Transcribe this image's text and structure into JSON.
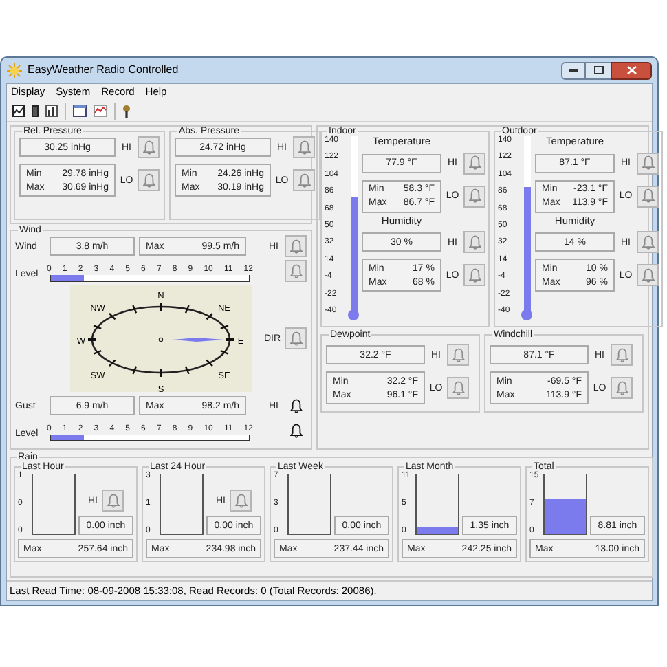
{
  "window": {
    "title": "EasyWeather Radio Controlled"
  },
  "menu": [
    "Display",
    "System",
    "Record",
    "Help"
  ],
  "pressure": [
    {
      "title": "Rel. Pressure",
      "value": "30.25 inHg",
      "hi_label": "HI",
      "lo_label": "LO",
      "min_label": "Min",
      "min": "29.78 inHg",
      "max_label": "Max",
      "max": "30.69 inHg"
    },
    {
      "title": "Abs. Pressure",
      "value": "24.72 inHg",
      "hi_label": "HI",
      "lo_label": "LO",
      "min_label": "Min",
      "min": "24.26 inHg",
      "max_label": "Max",
      "max": "30.19 inHg"
    }
  ],
  "wind": {
    "title": "Wind",
    "dir_label": "DIR",
    "compass": [
      "N",
      "NE",
      "E",
      "SE",
      "S",
      "SW",
      "W",
      "NW"
    ],
    "rows": [
      {
        "label": "Wind",
        "value": "3.8 m/h",
        "max_label": "Max",
        "max": "99.5 m/h",
        "hi_label": "HI",
        "alarm_active": false,
        "level_label": "Level",
        "scale": [
          "0",
          "1",
          "2",
          "3",
          "4",
          "5",
          "6",
          "7",
          "8",
          "9",
          "10",
          "11",
          "12"
        ],
        "level": 0.167
      },
      {
        "label": "Gust",
        "value": "6.9 m/h",
        "max_label": "Max",
        "max": "98.2 m/h",
        "hi_label": "HI",
        "alarm_active": true,
        "level_label": "Level",
        "scale": [
          "0",
          "1",
          "2",
          "3",
          "4",
          "5",
          "6",
          "7",
          "8",
          "9",
          "10",
          "11",
          "12"
        ],
        "level": 0.167
      }
    ]
  },
  "sensors": [
    {
      "title": "Indoor",
      "scale": [
        "140",
        "122",
        "104",
        "86",
        "68",
        "50",
        "32",
        "14",
        "-4",
        "-22",
        "-40"
      ],
      "level": 0.655,
      "sections": [
        {
          "title": "Temperature",
          "value": "77.9 °F",
          "hi_label": "HI",
          "lo_label": "LO",
          "min_label": "Min",
          "min": "58.3 °F",
          "max_label": "Max",
          "max": "86.7 °F"
        },
        {
          "title": "Humidity",
          "value": "30 %",
          "hi_label": "HI",
          "lo_label": "LO",
          "min_label": "Min",
          "min": "17 %",
          "max_label": "Max",
          "max": "68 %"
        }
      ]
    },
    {
      "title": "Outdoor",
      "scale": [
        "140",
        "122",
        "104",
        "86",
        "68",
        "50",
        "32",
        "14",
        "-4",
        "-22",
        "-40"
      ],
      "level": 0.706,
      "sections": [
        {
          "title": "Temperature",
          "value": "87.1 °F",
          "hi_label": "HI",
          "lo_label": "LO",
          "min_label": "Min",
          "min": "-23.1 °F",
          "max_label": "Max",
          "max": "113.9 °F"
        },
        {
          "title": "Humidity",
          "value": "14 %",
          "hi_label": "HI",
          "lo_label": "LO",
          "min_label": "Min",
          "min": "10 %",
          "max_label": "Max",
          "max": "96 %"
        }
      ]
    }
  ],
  "derived": [
    {
      "title": "Dewpoint",
      "value": "32.2 °F",
      "hi_label": "HI",
      "lo_label": "LO",
      "min_label": "Min",
      "min": "32.2 °F",
      "max_label": "Max",
      "max": "96.1 °F"
    },
    {
      "title": "Windchill",
      "value": "87.1 °F",
      "hi_label": "HI",
      "lo_label": "LO",
      "min_label": "Min",
      "min": "-69.5 °F",
      "max_label": "Max",
      "max": "113.9 °F"
    }
  ],
  "rain": {
    "title": "Rain",
    "periods": [
      {
        "title": "Last Hour",
        "scale": [
          "1",
          "0",
          "0"
        ],
        "level": 0,
        "hi_label": "HI",
        "value": "0.00 inch",
        "max_label": "Max",
        "max": "257.64 inch"
      },
      {
        "title": "Last 24 Hour",
        "scale": [
          "3",
          "1",
          "0"
        ],
        "level": 0,
        "hi_label": "HI",
        "value": "0.00 inch",
        "max_label": "Max",
        "max": "234.98 inch"
      },
      {
        "title": "Last Week",
        "scale": [
          "7",
          "3",
          "0"
        ],
        "level": 0,
        "value": "0.00 inch",
        "max_label": "Max",
        "max": "237.44 inch"
      },
      {
        "title": "Last Month",
        "scale": [
          "11",
          "5",
          "0"
        ],
        "level": 0.12,
        "value": "1.35 inch",
        "max_label": "Max",
        "max": "242.25 inch"
      },
      {
        "title": "Total",
        "scale": [
          "15",
          "7",
          "0"
        ],
        "level": 0.59,
        "value": "8.81 inch",
        "max_label": "Max",
        "max": "13.00 inch"
      }
    ]
  },
  "status_bar": "Last Read Time: 08-09-2008 15:33:08, Read Records: 0 (Total Records: 20086)."
}
